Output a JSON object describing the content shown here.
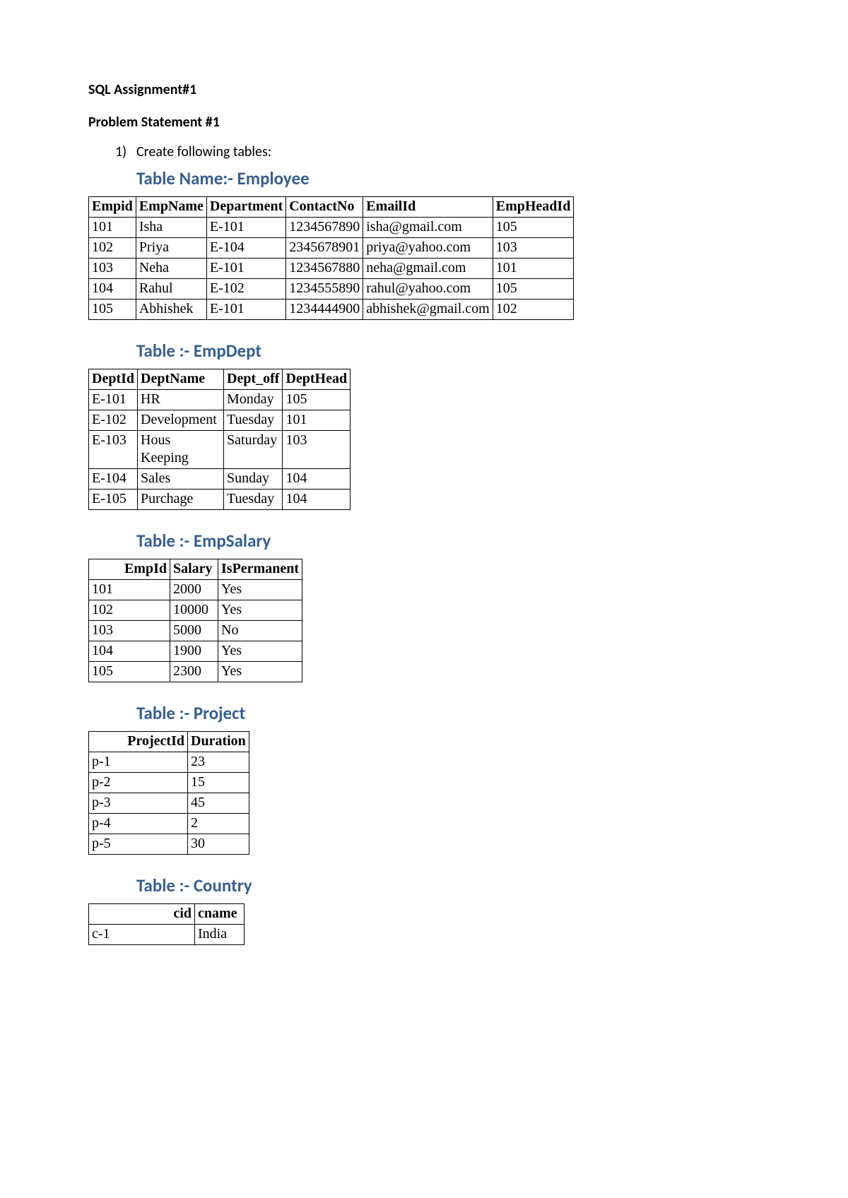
{
  "title": "SQL Assignment#1",
  "problem_heading": "Problem Statement #1",
  "list_marker": "1)",
  "list_text": "Create following tables:",
  "tables": {
    "employee": {
      "heading": "Table Name:- Employee",
      "cols": [
        "Empid",
        "EmpName",
        "Department",
        "ContactNo",
        "EmailId",
        "EmpHeadId"
      ],
      "rows": [
        [
          "101",
          "Isha",
          "E-101",
          "1234567890",
          "isha@gmail.com",
          "105"
        ],
        [
          "102",
          "Priya",
          "E-104",
          "2345678901",
          "priya@yahoo.com",
          "103"
        ],
        [
          "103",
          "Neha",
          "E-101",
          "1234567880",
          "neha@gmail.com",
          "101"
        ],
        [
          "104",
          "Rahul",
          "E-102",
          "1234555890",
          "rahul@yahoo.com",
          "105"
        ],
        [
          "105",
          "Abhishek",
          "E-101",
          "1234444900",
          "abhishek@gmail.com",
          "102"
        ]
      ]
    },
    "empdept": {
      "heading": "Table :- EmpDept",
      "cols": [
        "DeptId",
        "DeptName",
        "Dept_off",
        "DeptHead"
      ],
      "rows": [
        [
          "E-101",
          "HR",
          "Monday",
          "105"
        ],
        [
          "E-102",
          "Development",
          "Tuesday",
          "101"
        ],
        [
          "E-103",
          "Hous Keeping",
          "Saturday",
          "103"
        ],
        [
          "E-104",
          "Sales",
          "Sunday",
          "104"
        ],
        [
          "E-105",
          "Purchage",
          "Tuesday",
          "104"
        ]
      ]
    },
    "empsalary": {
      "heading": "Table :- EmpSalary",
      "cols": [
        "EmpId",
        "Salary",
        "IsPermanent"
      ],
      "rows": [
        [
          "101",
          "2000",
          "Yes"
        ],
        [
          "102",
          "10000",
          "Yes"
        ],
        [
          "103",
          "5000",
          "No"
        ],
        [
          "104",
          "1900",
          "Yes"
        ],
        [
          "105",
          "2300",
          "Yes"
        ]
      ]
    },
    "project": {
      "heading": "Table :- Project",
      "cols": [
        "ProjectId",
        "Duration"
      ],
      "rows": [
        [
          "p-1",
          "23"
        ],
        [
          "p-2",
          "15"
        ],
        [
          "p-3",
          "45"
        ],
        [
          "p-4",
          "2"
        ],
        [
          "p-5",
          "30"
        ]
      ]
    },
    "country": {
      "heading": "Table :- Country",
      "cols": [
        "cid",
        "cname"
      ],
      "rows": [
        [
          "c-1",
          "India"
        ]
      ]
    }
  }
}
